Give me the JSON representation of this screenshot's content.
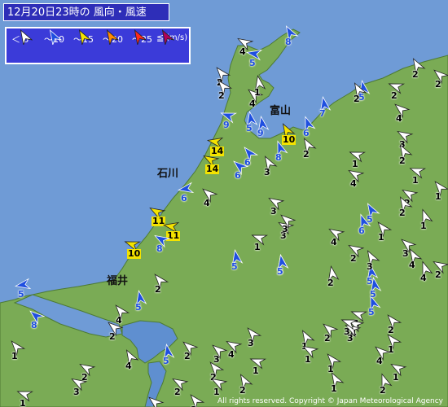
{
  "title": "12月20日23時の 風向・風速",
  "legend": {
    "thresholds": [
      "＜ 5",
      "～10",
      "～15",
      "～20",
      "～25",
      "≦"
    ],
    "unit": "(m/s)",
    "classes": [
      {
        "range": "< 5",
        "color": "#ffffff"
      },
      {
        "range": "5-10",
        "color": "#1f4fe0"
      },
      {
        "range": "10-15",
        "color": "#f4e300"
      },
      {
        "range": "15-20",
        "color": "#ff8c00"
      },
      {
        "range": "20-25",
        "color": "#ff2a1a"
      },
      {
        "range": ">= 25",
        "color": "#b0005a"
      }
    ]
  },
  "labels": [
    "石川",
    "富山",
    "福井"
  ],
  "copyright": "All rights reserved. Copyright © Japan Meteorological Agency",
  "colors": {
    "sea": "#6f9bd6",
    "land": "#7aab55",
    "water_inland": "#5f8fd0"
  },
  "stations": [
    {
      "v": "8",
      "c": "blue",
      "d": 150
    },
    {
      "v": "4",
      "c": "white",
      "d": 120
    },
    {
      "v": "5",
      "c": "blue",
      "d": 100
    },
    {
      "v": "2",
      "c": "white",
      "d": 140
    },
    {
      "v": "4",
      "c": "white",
      "d": 130
    },
    {
      "v": "9",
      "c": "blue",
      "d": 110
    },
    {
      "v": "5",
      "c": "blue",
      "d": 170
    },
    {
      "v": "9",
      "c": "blue",
      "d": 170
    },
    {
      "v": "14",
      "c": "yellow",
      "d": 100
    },
    {
      "v": "6",
      "c": "blue",
      "d": 140
    },
    {
      "v": "6",
      "c": "blue",
      "d": 130
    },
    {
      "v": "14",
      "c": "yellow",
      "d": 120
    },
    {
      "v": "3",
      "c": "white",
      "d": 150
    },
    {
      "v": "8",
      "c": "blue",
      "d": 160
    },
    {
      "v": "10",
      "c": "yellow",
      "d": 150
    },
    {
      "v": "6",
      "c": "blue",
      "d": 160
    },
    {
      "v": "2",
      "c": "white",
      "d": 150
    },
    {
      "v": "7",
      "c": "blue",
      "d": 170
    },
    {
      "v": "5",
      "c": "blue",
      "d": 170
    },
    {
      "v": "6",
      "c": "blue",
      "d": 80
    },
    {
      "v": "4",
      "c": "white",
      "d": 130
    },
    {
      "v": "2",
      "c": "white",
      "d": 140
    },
    {
      "v": "1",
      "c": "white",
      "d": 170
    },
    {
      "v": "3",
      "c": "white",
      "d": 120
    },
    {
      "v": "11",
      "c": "yellow",
      "d": 120
    },
    {
      "v": "11",
      "c": "yellow",
      "d": 100
    },
    {
      "v": "8",
      "c": "blue",
      "d": 120
    },
    {
      "v": "10",
      "c": "yellow",
      "d": 110
    },
    {
      "v": "1",
      "c": "white",
      "d": 110
    },
    {
      "v": "5",
      "c": "blue",
      "d": 170
    },
    {
      "v": "5",
      "c": "blue",
      "d": 170
    },
    {
      "v": "2",
      "c": "white",
      "d": 140
    },
    {
      "v": "5",
      "c": "blue",
      "d": 80
    },
    {
      "v": "8",
      "c": "blue",
      "d": 130
    },
    {
      "v": "5",
      "c": "blue",
      "d": 170
    },
    {
      "v": "4",
      "c": "white",
      "d": 140
    },
    {
      "v": "3",
      "c": "white",
      "d": 120
    },
    {
      "v": "2",
      "c": "white",
      "d": 150
    },
    {
      "v": "3",
      "c": "white",
      "d": 120
    },
    {
      "v": "4",
      "c": "white",
      "d": 130
    },
    {
      "v": "5",
      "c": "blue",
      "d": 150
    },
    {
      "v": "4",
      "c": "white",
      "d": 120
    },
    {
      "v": "1",
      "c": "white",
      "d": 110
    },
    {
      "v": "2",
      "c": "white",
      "d": 150
    },
    {
      "v": "2",
      "c": "white",
      "d": 120
    },
    {
      "v": "2",
      "c": "white",
      "d": 150
    },
    {
      "v": "1",
      "c": "white",
      "d": 110
    },
    {
      "v": "1",
      "c": "white",
      "d": 140
    },
    {
      "v": "2",
      "c": "white",
      "d": 110
    },
    {
      "v": "2",
      "c": "white",
      "d": 150
    },
    {
      "v": "2",
      "c": "white",
      "d": 130
    },
    {
      "v": "3",
      "c": "white",
      "d": 130
    },
    {
      "v": "5",
      "c": "blue",
      "d": 170
    },
    {
      "v": "4",
      "c": "white",
      "d": 120
    },
    {
      "v": "1",
      "c": "white",
      "d": 160
    },
    {
      "v": "1",
      "c": "white",
      "d": 140
    },
    {
      "v": "3",
      "c": "white",
      "d": 150
    },
    {
      "v": "2",
      "c": "white",
      "d": 120
    },
    {
      "v": "5",
      "c": "blue",
      "d": 160
    },
    {
      "v": "2",
      "c": "white",
      "d": 170
    },
    {
      "v": "2",
      "c": "white",
      "d": 120
    },
    {
      "v": "4",
      "c": "white",
      "d": 150
    },
    {
      "v": "1",
      "c": "white",
      "d": 110
    },
    {
      "v": "2",
      "c": "white",
      "d": 140
    },
    {
      "v": "4",
      "c": "white",
      "d": 120
    },
    {
      "v": "6",
      "c": "blue",
      "d": 160
    },
    {
      "v": "5",
      "c": "blue",
      "d": 170
    },
    {
      "v": "3",
      "c": "white",
      "d": 130
    },
    {
      "v": "4",
      "c": "white",
      "d": 160
    },
    {
      "v": "5",
      "c": "blue",
      "d": 170
    },
    {
      "v": "4",
      "c": "white",
      "d": 120
    },
    {
      "v": "3",
      "c": "white",
      "d": 140
    },
    {
      "v": "1",
      "c": "white",
      "d": 110
    },
    {
      "v": "3",
      "c": "white",
      "d": 130
    },
    {
      "v": "2",
      "c": "white",
      "d": 140
    },
    {
      "v": "1",
      "c": "white",
      "d": 120
    },
    {
      "v": "2",
      "c": "white",
      "d": 150
    },
    {
      "v": "2",
      "c": "white",
      "d": 130
    },
    {
      "v": "2",
      "c": "white",
      "d": 120
    },
    {
      "v": "1",
      "c": "white",
      "d": 150
    },
    {
      "v": "1",
      "c": "white",
      "d": 120
    },
    {
      "v": "2",
      "c": "white",
      "d": 130
    },
    {
      "v": "1",
      "c": "white",
      "d": 140
    },
    {
      "v": "3",
      "c": "white",
      "d": 120
    },
    {
      "v": "3",
      "c": "white",
      "d": 110
    },
    {
      "v": "1",
      "c": "white",
      "d": 150
    },
    {
      "v": "4",
      "c": "white",
      "d": 130
    },
    {
      "v": "1",
      "c": "white",
      "d": 140
    },
    {
      "v": "2",
      "c": "white",
      "d": 160
    },
    {
      "v": "1",
      "c": "white",
      "d": 120
    },
    {
      "v": "5",
      "c": "blue",
      "d": 170
    },
    {
      "v": "2",
      "c": "white",
      "d": 130
    },
    {
      "v": "3",
      "c": "white",
      "d": 140
    },
    {
      "v": "2",
      "c": "white",
      "d": 120
    },
    {
      "v": "3",
      "c": "white",
      "d": 120
    },
    {
      "v": "1",
      "c": "white",
      "d": 110
    },
    {
      "v": "1",
      "c": "white",
      "d": 140
    },
    {
      "v": "2",
      "c": "white",
      "d": 130
    },
    {
      "v": "4",
      "c": "white",
      "d": 150
    }
  ]
}
